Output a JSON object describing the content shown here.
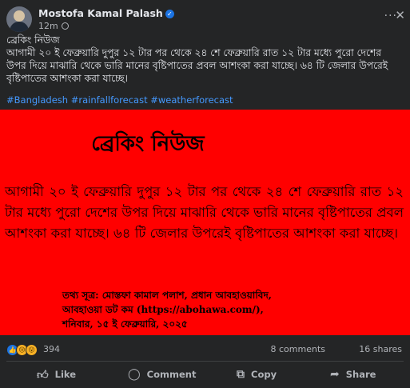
{
  "header": {
    "author": "Mostofa Kamal Palash",
    "time": "12m",
    "more_label": "···",
    "close_label": "✕"
  },
  "post": {
    "line1": "ব্রেকিং নিউজ",
    "line2": "আগামী ২০ ই ফেব্রুয়ারি দুপুর ১২ টার পর থেকে ২৪ শে ফেব্রুয়ারি রাত ১২ টার মধ্যে পুরো দেশের উপর দিয়ে মাঝারি থেকে ভারি মানের বৃষ্টিপাতের প্রবল আশংকা করা যাচ্ছে। ৬৪ টি জেলার উপরেই বৃষ্টিপাতের আশংকা করা যাচ্ছে।",
    "hashtags": "#Bangladesh #rainfallforecast #weatherforecast"
  },
  "banner": {
    "title": "ব্রেকিং নিউজ",
    "body": "আগামী ২০ ই ফেব্রুয়ারি দুপুর ১২ টার পর থেকে ২৪ শে ফেব্রুয়ারি রাত ১২ টার মধ্যে পুরো দেশের উপর দিয়ে মাঝারি থেকে ভারি মানের বৃষ্টিপাতের প্রবল আশংকা করা যাচ্ছে। ৬৪ টি জেলার উপরেই বৃষ্টিপাতের আশংকা করা যাচ্ছে।",
    "source1": "তথ্য সূত্র:  মোস্তফা কামাল পলাশ, প্রধান আবহাওয়াবিদ,",
    "source2": "আবহাওয়া ডট কম (https://abohawa.com/),",
    "source3": "শনিবার, ১৫ ই ফেব্রুয়ারি, ২০২৫",
    "color": "#ff0000"
  },
  "stats": {
    "reactions": "394",
    "comments": "8 comments",
    "shares": "16 shares"
  },
  "actions": {
    "like": "Like",
    "comment": "Comment",
    "copy": "Copy",
    "share": "Share"
  }
}
